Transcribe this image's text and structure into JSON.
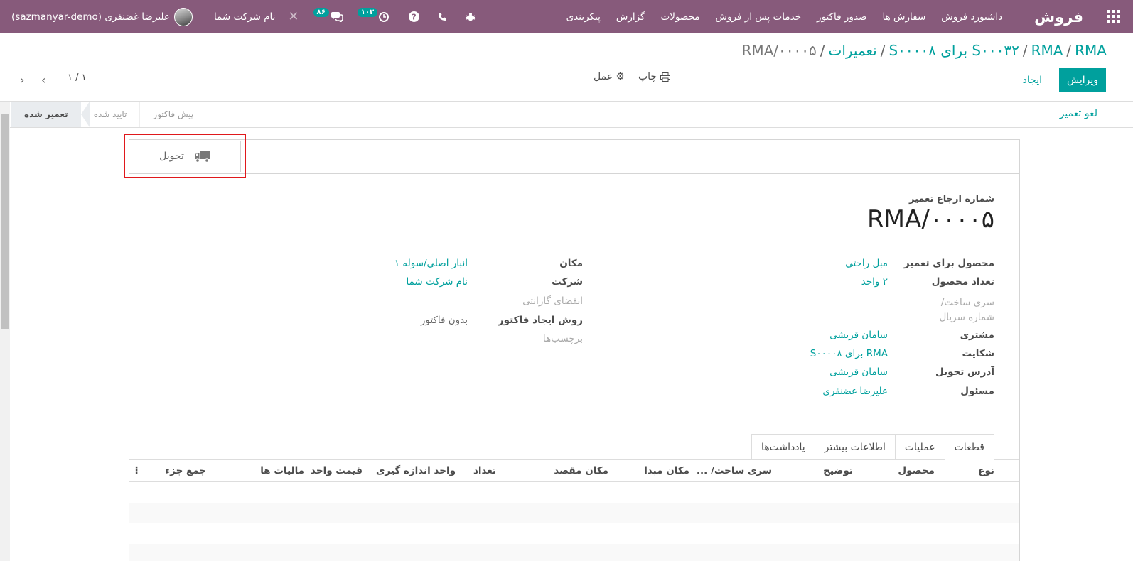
{
  "navbar": {
    "brand": "فروش",
    "menu": [
      "داشبورد فروش",
      "سفارش ها",
      "صدور فاکتور",
      "خدمات پس از فروش",
      "محصولات",
      "گزارش",
      "پیکربندی"
    ],
    "company": "نام شرکت شما",
    "user": "علیرضا غضنفری (sazmanyar-demo)",
    "badge_messages": "۸۶",
    "badge_activities": "۱۰۳",
    "color": "#875a7b"
  },
  "breadcrumb": {
    "items": [
      "S۰۰۰۳۲",
      "RMA",
      "RMA برای S۰۰۰۰۸",
      "تعمیرات"
    ],
    "current": "RMA/۰۰۰۰۵"
  },
  "controls": {
    "edit_label": "ویرایش",
    "create_label": "ایجاد",
    "print_label": "چاپ",
    "action_label": "عمل",
    "pager": "۱ / ۱"
  },
  "statusbar": {
    "cancel_label": "لغو تعمیر",
    "stages": [
      "تعمیر شده",
      "تایید شده",
      "پیش فاکتور"
    ],
    "active_stage": "تعمیر شده"
  },
  "smart_button": {
    "label": "تحویل"
  },
  "form": {
    "ref_label": "شماره ارجاع تعمیر",
    "ref_value": "RMA/۰۰۰۰۵",
    "right_fields": [
      {
        "label": "محصول برای تعمیر",
        "value": "مبل راحتی"
      },
      {
        "label": "تعداد محصول",
        "value": "۲   واحد"
      },
      {
        "label": "سری ساخت/ شماره سریال",
        "value": ""
      },
      {
        "label": "مشتری",
        "value": "سامان قریشی"
      },
      {
        "label": "شکایت",
        "value": "RMA برای S۰۰۰۰۸"
      },
      {
        "label": "آدرس تحویل",
        "value": "سامان قریشی"
      },
      {
        "label": "مسئول",
        "value": "علیرضا غضنفری"
      }
    ],
    "left_fields": [
      {
        "label": "مکان",
        "value": "انبار اصلی/سوله ۱"
      },
      {
        "label": "شرکت",
        "value": "نام شرکت شما"
      },
      {
        "label": "انقضای گارانتی",
        "value": ""
      },
      {
        "label": "روش ایجاد فاکتور",
        "value": "بدون فاکتور"
      },
      {
        "label": "برچسب‌ها",
        "value": ""
      }
    ]
  },
  "tabs": [
    "قطعات",
    "عملیات",
    "اطلاعات بیشتر",
    "یادداشت‌ها"
  ],
  "table": {
    "columns": [
      "نوع",
      "محصول",
      "توضیح",
      "سری ساخت/ ...",
      "مکان مبدا",
      "مکان مقصد",
      "تعداد",
      "واحد اندازه گیری",
      "قیمت واحد",
      "مالیات ها",
      "جمع جزء"
    ]
  }
}
